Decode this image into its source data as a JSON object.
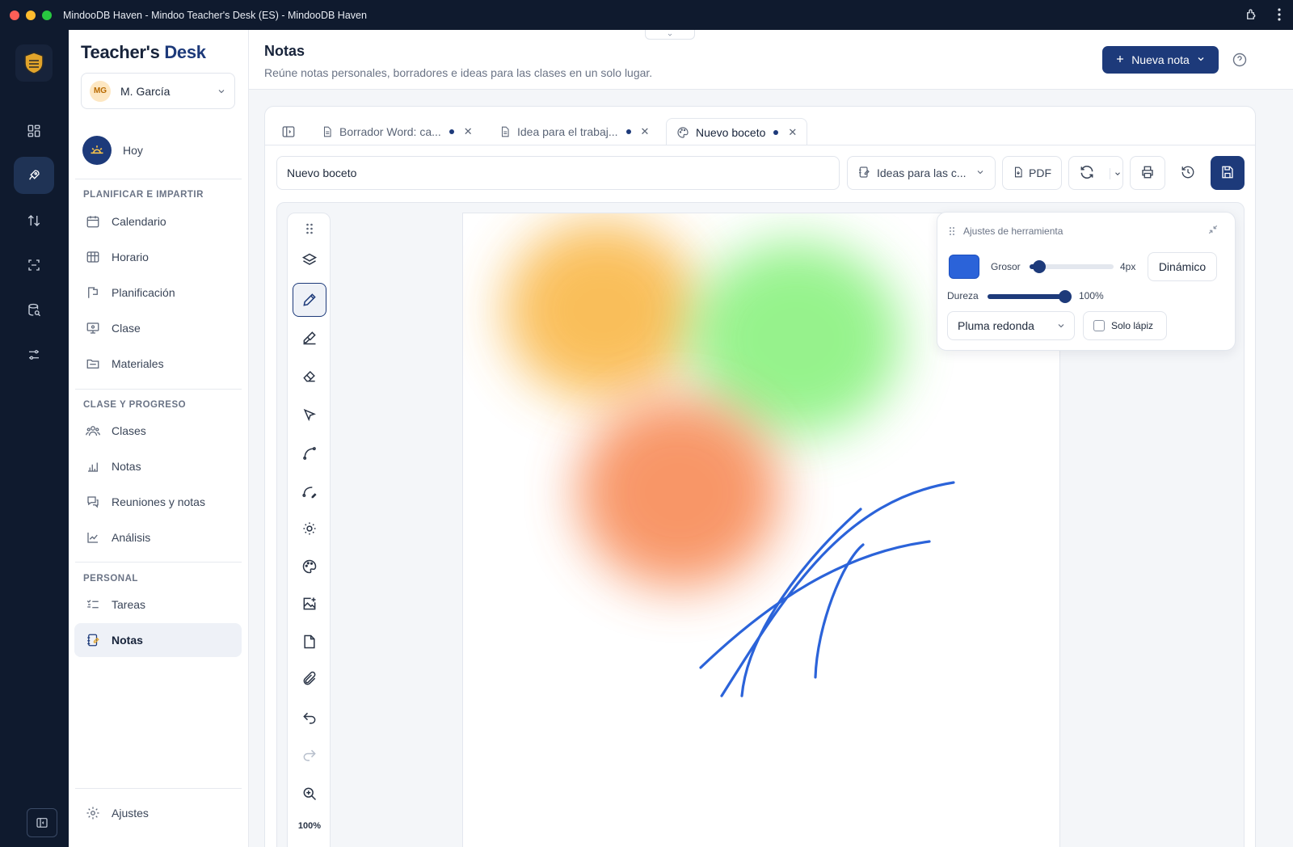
{
  "window": {
    "title": "MindooDB Haven - Mindoo Teacher's Desk (ES) - MindooDB Haven"
  },
  "brand": {
    "part1": "Teacher's",
    "part2": "Desk"
  },
  "user": {
    "initials": "MG",
    "name": "M. García"
  },
  "today": {
    "label": "Hoy"
  },
  "sections": {
    "plan": "PLANIFICAR E IMPARTIR",
    "class": "CLASE Y PROGRESO",
    "personal": "PERSONAL"
  },
  "nav": {
    "calendario": "Calendario",
    "horario": "Horario",
    "planificacion": "Planificación",
    "clase": "Clase",
    "materiales": "Materiales",
    "clases": "Clases",
    "notas_grades": "Notas",
    "reuniones": "Reuniones y notas",
    "analisis": "Análisis",
    "tareas": "Tareas",
    "notas": "Notas",
    "ajustes": "Ajustes"
  },
  "header": {
    "title": "Notas",
    "subtitle": "Reúne notas personales, borradores e ideas para las clases en un solo lugar.",
    "new_note": "Nueva nota"
  },
  "tabs": [
    {
      "label": "Borrador Word: ca...",
      "icon": "document-icon"
    },
    {
      "label": "Idea para el trabaj...",
      "icon": "document-icon"
    },
    {
      "label": "Nuevo boceto",
      "icon": "palette-icon"
    }
  ],
  "toolbar": {
    "title_value": "Nuevo boceto",
    "folder": "Ideas para las c...",
    "pdf": "PDF"
  },
  "tool_settings": {
    "title": "Ajustes de herramienta",
    "thickness_label": "Grosor",
    "thickness_value": "4px",
    "thickness_fraction": 0.04,
    "dynamic": "Dinámico",
    "hardness_label": "Dureza",
    "hardness_value": "100%",
    "hardness_fraction": 1.0,
    "brush": "Pluma redonda",
    "pencil_only": "Solo lápiz",
    "color": "#2b63d9"
  },
  "zoom": "100%",
  "colors": {
    "accent": "#1d3a7a",
    "rail": "#0f1a2e",
    "stroke": "#2b63d9",
    "blob_orange": "#f9b84a",
    "blob_green": "#7cf06f",
    "blob_red": "#f7844e"
  }
}
